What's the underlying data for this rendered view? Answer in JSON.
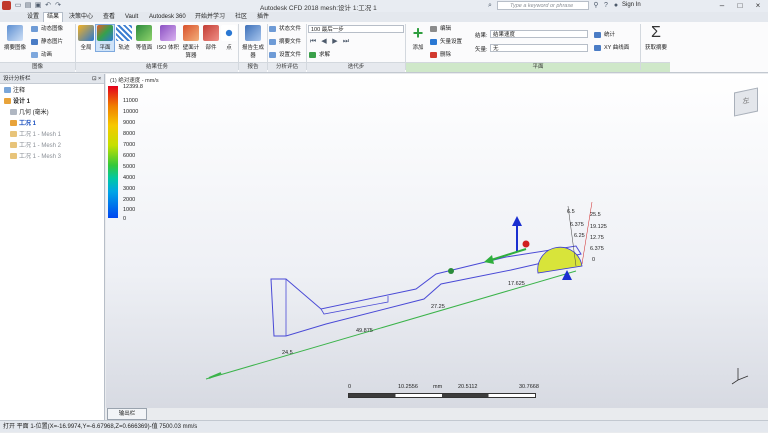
{
  "titlebar": {
    "title": "Autodesk CFD 2018   mesh:设计 1:工况 1",
    "search_placeholder": "Type a keyword or phrase",
    "signin": "Sign In"
  },
  "tabs": [
    "设置",
    "结果",
    "决策中心",
    "查看",
    "Vault",
    "Autodesk 360",
    "开始并学习",
    "社区",
    "插件"
  ],
  "active_tab": "结果",
  "ribbon": {
    "image_group": {
      "big_label": "摘要图像",
      "items": [
        "动态图像",
        "静态图片",
        "动画"
      ],
      "label": "图像"
    },
    "results_group": {
      "buttons": [
        "全局",
        "平面",
        "轨迹",
        "等值面",
        "ISO 体积",
        "壁面计算器",
        "部件",
        "点"
      ],
      "label": "结果任务"
    },
    "report_group": {
      "button": "报告生成器",
      "label": "报告"
    },
    "analysis_group": {
      "items": [
        "状态文件",
        "摘要文件",
        "设置文件"
      ],
      "label": "分析评估"
    },
    "iteration_group": {
      "combo": "100 最后一步",
      "solve": "求解",
      "label": "迭代步"
    },
    "plane_group": {
      "add": "添加",
      "items": [
        "编辑",
        "矢量设置",
        "删除"
      ],
      "result_label": "结果:",
      "result_value": "结果速度",
      "vector_label": "矢量:",
      "vector_value": "无",
      "stats": "统计",
      "xy": "XY 曲线面",
      "label": "平面"
    },
    "summary_group": {
      "button": "获取摘要"
    }
  },
  "left_panel": {
    "header": "设计分析栏",
    "tree": [
      "注释",
      "设计 1",
      "几何 (毫米)",
      "工况 1",
      "工况 1 - Mesh 1",
      "工况 1 - Mesh 2",
      "工况 1 - Mesh 3"
    ]
  },
  "viewport": {
    "caption": "(1) 绝对速度 - mm/s",
    "legend": [
      "12399.8",
      "11000",
      "10000",
      "9000",
      "8000",
      "7000",
      "6000",
      "5000",
      "4000",
      "3000",
      "2000",
      "1000",
      "0"
    ],
    "axis_labels": [
      "24.5",
      "49.875",
      "27.25",
      "17.625",
      "6.5",
      "6.375",
      "6.25",
      "25.5",
      "19.125",
      "12.75",
      "6.375",
      "0"
    ],
    "scale": [
      "0",
      "10.2556",
      "mm",
      "20.5112",
      "30.7668"
    ],
    "viewcube": "左"
  },
  "output_tab": "输出栏",
  "status": "打开 平面 1-位置(X=-16.9974,Y=-6.67968,Z=0.666369)-值 7500.03  mm/s"
}
